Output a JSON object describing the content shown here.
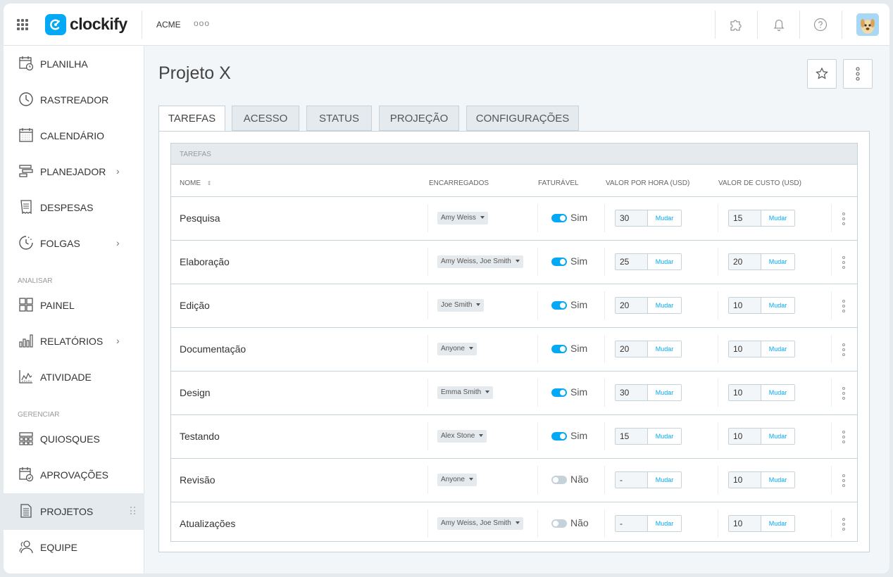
{
  "header": {
    "logo_text": "clockify",
    "workspace": "ACME",
    "workspace_more": "ooo"
  },
  "sidebar": {
    "items": [
      {
        "label": "PLANILHA",
        "icon": "timesheet-icon"
      },
      {
        "label": "RASTREADOR",
        "icon": "clock-icon"
      },
      {
        "label": "CALENDÁRIO",
        "icon": "calendar-icon"
      },
      {
        "label": "PLANEJADOR",
        "icon": "planner-icon",
        "chevron": "›"
      },
      {
        "label": "DESPESAS",
        "icon": "receipt-icon"
      },
      {
        "label": "FOLGAS",
        "icon": "time-off-icon",
        "chevron": "›"
      },
      {
        "label": "PAINEL",
        "icon": "dashboard-icon"
      },
      {
        "label": "RELATÓRIOS",
        "icon": "reports-icon",
        "chevron": "›"
      },
      {
        "label": "ATIVIDADE",
        "icon": "activity-icon"
      },
      {
        "label": "QUIOSQUES",
        "icon": "kiosk-icon"
      },
      {
        "label": "APROVAÇÕES",
        "icon": "approvals-icon"
      },
      {
        "label": "PROJETOS",
        "icon": "projects-icon",
        "active": true
      },
      {
        "label": "EQUIPE",
        "icon": "team-icon"
      }
    ],
    "sections": {
      "analyze": "ANALISAR",
      "manage": "GERENCIAR"
    }
  },
  "page": {
    "title": "Projeto X",
    "tabs": [
      "TAREFAS",
      "ACESSO",
      "STATUS",
      "PROJEÇÃO",
      "CONFIGURAÇÕES"
    ],
    "active_tab": "TAREFAS"
  },
  "table": {
    "caption": "TAREFAS",
    "columns": {
      "name": "NOME",
      "sort_icon": "⇕",
      "assignees": "ENCARREGADOS",
      "billable": "FATURÁVEL",
      "hourly_rate": "VALOR POR HORA (USD)",
      "cost_rate": "VALOR DE CUSTO (USD)"
    },
    "change_label": "Mudar",
    "rows": [
      {
        "name": "Pesquisa",
        "assignees": "Amy Weiss",
        "billable": "Sim",
        "billable_on": true,
        "hourly": "30",
        "cost": "15"
      },
      {
        "name": "Elaboração",
        "assignees": "Amy Weiss, Joe Smith",
        "billable": "Sim",
        "billable_on": true,
        "hourly": "25",
        "cost": "20"
      },
      {
        "name": "Edição",
        "assignees": "Joe Smith",
        "billable": "Sim",
        "billable_on": true,
        "hourly": "20",
        "cost": "10"
      },
      {
        "name": "Documentação",
        "assignees": "Anyone",
        "billable": "Sim",
        "billable_on": true,
        "hourly": "20",
        "cost": "10"
      },
      {
        "name": "Design",
        "assignees": "Emma Smith",
        "billable": "Sim",
        "billable_on": true,
        "hourly": "30",
        "cost": "10"
      },
      {
        "name": "Testando",
        "assignees": "Alex Stone",
        "billable": "Sim",
        "billable_on": true,
        "hourly": "15",
        "cost": "10"
      },
      {
        "name": "Revisão",
        "assignees": "Anyone",
        "billable": "Não",
        "billable_on": false,
        "hourly": "-",
        "cost": "10"
      },
      {
        "name": "Atualizações",
        "assignees": "Amy Weiss, Joe Smith",
        "billable": "Não",
        "billable_on": false,
        "hourly": "-",
        "cost": "10"
      }
    ]
  },
  "colors": {
    "accent": "#03a9f4",
    "sidebar_active": "#e4eaee",
    "border": "#c6d2d9"
  }
}
